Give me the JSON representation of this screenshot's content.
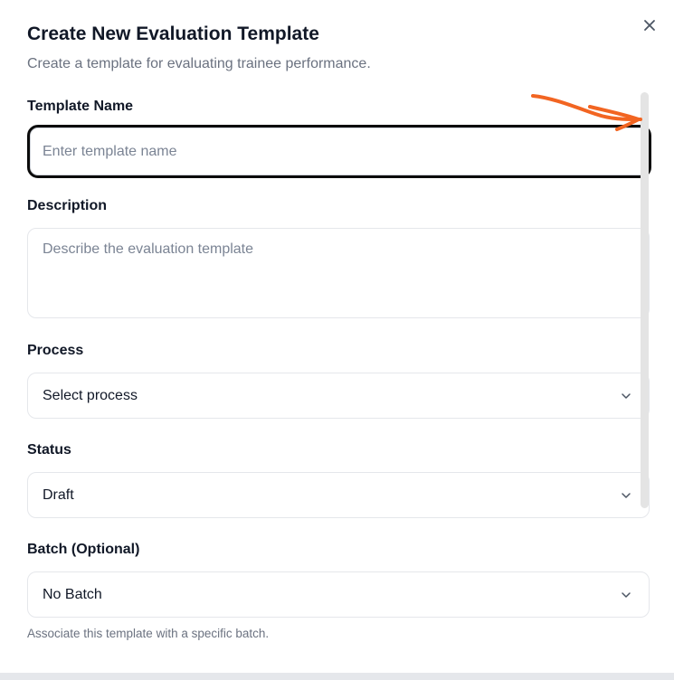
{
  "dialog": {
    "title": "Create New Evaluation Template",
    "subtitle": "Create a template for evaluating trainee performance.",
    "close_icon": "close-icon"
  },
  "form": {
    "template_name": {
      "label": "Template Name",
      "placeholder": "Enter template name",
      "value": ""
    },
    "description": {
      "label": "Description",
      "placeholder": "Describe the evaluation template",
      "value": ""
    },
    "process": {
      "label": "Process",
      "selected": "Select process",
      "icon": "chevron-down-icon"
    },
    "status": {
      "label": "Status",
      "selected": "Draft",
      "icon": "chevron-down-icon"
    },
    "batch": {
      "label": "Batch (Optional)",
      "selected": "No Batch",
      "icon": "chevron-down-icon",
      "help_text": "Associate this template with a specific batch."
    }
  },
  "annotation": {
    "icon": "hand-drawn-arrow-icon",
    "color": "#f26522"
  },
  "colors": {
    "focus_border": "#0b0b0b",
    "muted_text": "#6b7280",
    "border": "#e5e7eb"
  }
}
